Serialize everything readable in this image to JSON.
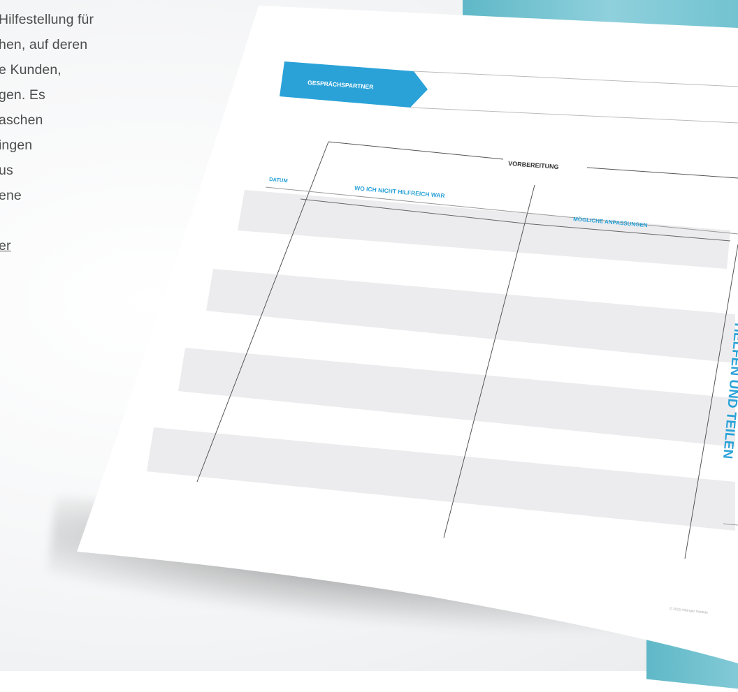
{
  "intro_text": {
    "lines": [
      "Hilfestellung für",
      "hen, auf deren",
      "e Kunden,",
      "gen. Es",
      "aschen",
      "ingen",
      "us",
      "ene",
      "",
      "er"
    ]
  },
  "worksheet": {
    "partner_label": "GESPRÄCHSPARTNER",
    "section_title": "VORBEREITUNG",
    "columns": [
      "DATUM",
      "WO ICH NICHT HILFREICH WAR",
      "MÖGLICHE ANPASSUNGEN"
    ],
    "side_title": "HELFEN UND TEILEN",
    "footer": "© 2021 Arbinger Institute"
  },
  "colors": {
    "accent": "#2aa2d8",
    "row_gray": "#ececee",
    "teal": "#6ec1cf"
  }
}
